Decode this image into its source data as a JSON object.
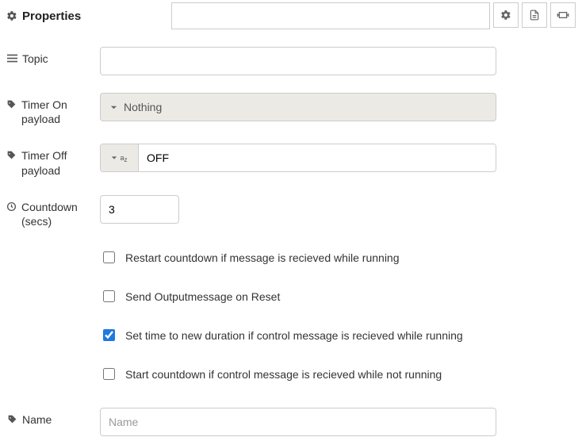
{
  "header": {
    "title": "Properties"
  },
  "labels": {
    "topic": "Topic",
    "timer_on": "Timer On payload",
    "timer_off": "Timer Off payload",
    "countdown": "Countdown (secs)",
    "name": "Name"
  },
  "fields": {
    "topic": "",
    "timer_on_display": "Nothing",
    "timer_off_value": "OFF",
    "countdown": "3",
    "name": "",
    "name_placeholder": "Name"
  },
  "checkboxes": {
    "restart": {
      "label": "Restart countdown if message is recieved while running",
      "checked": false
    },
    "reset_output": {
      "label": "Send Outputmessage on Reset",
      "checked": false
    },
    "set_time": {
      "label": "Set time to new duration if control message is recieved while running",
      "checked": true
    },
    "start_if_not": {
      "label": "Start countdown if control message is recieved while not running",
      "checked": false
    }
  }
}
